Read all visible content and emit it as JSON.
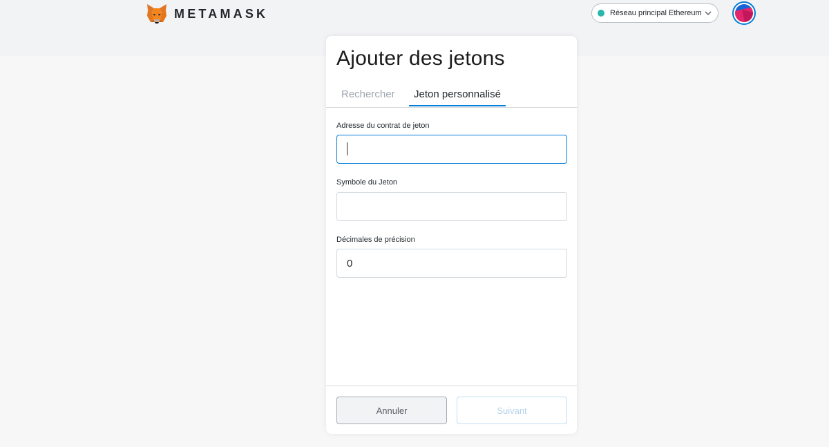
{
  "header": {
    "brand": "METAMASK",
    "network": {
      "label": "Réseau principal Ethereum",
      "status_color": "#29b6af"
    }
  },
  "modal": {
    "title": "Ajouter des jetons",
    "tabs": [
      {
        "label": "Rechercher",
        "active": false
      },
      {
        "label": "Jeton personnalisé",
        "active": true
      }
    ],
    "fields": {
      "address": {
        "label": "Adresse du contrat de jeton",
        "value": ""
      },
      "symbol": {
        "label": "Symbole du Jeton",
        "value": ""
      },
      "decimals": {
        "label": "Décimales de précision",
        "value": "0"
      }
    },
    "buttons": {
      "cancel": "Annuler",
      "next": "Suivant"
    }
  },
  "colors": {
    "accent": "#037dd6",
    "page_background": "#f7f7f7",
    "header_band": "#f2f3f4"
  }
}
